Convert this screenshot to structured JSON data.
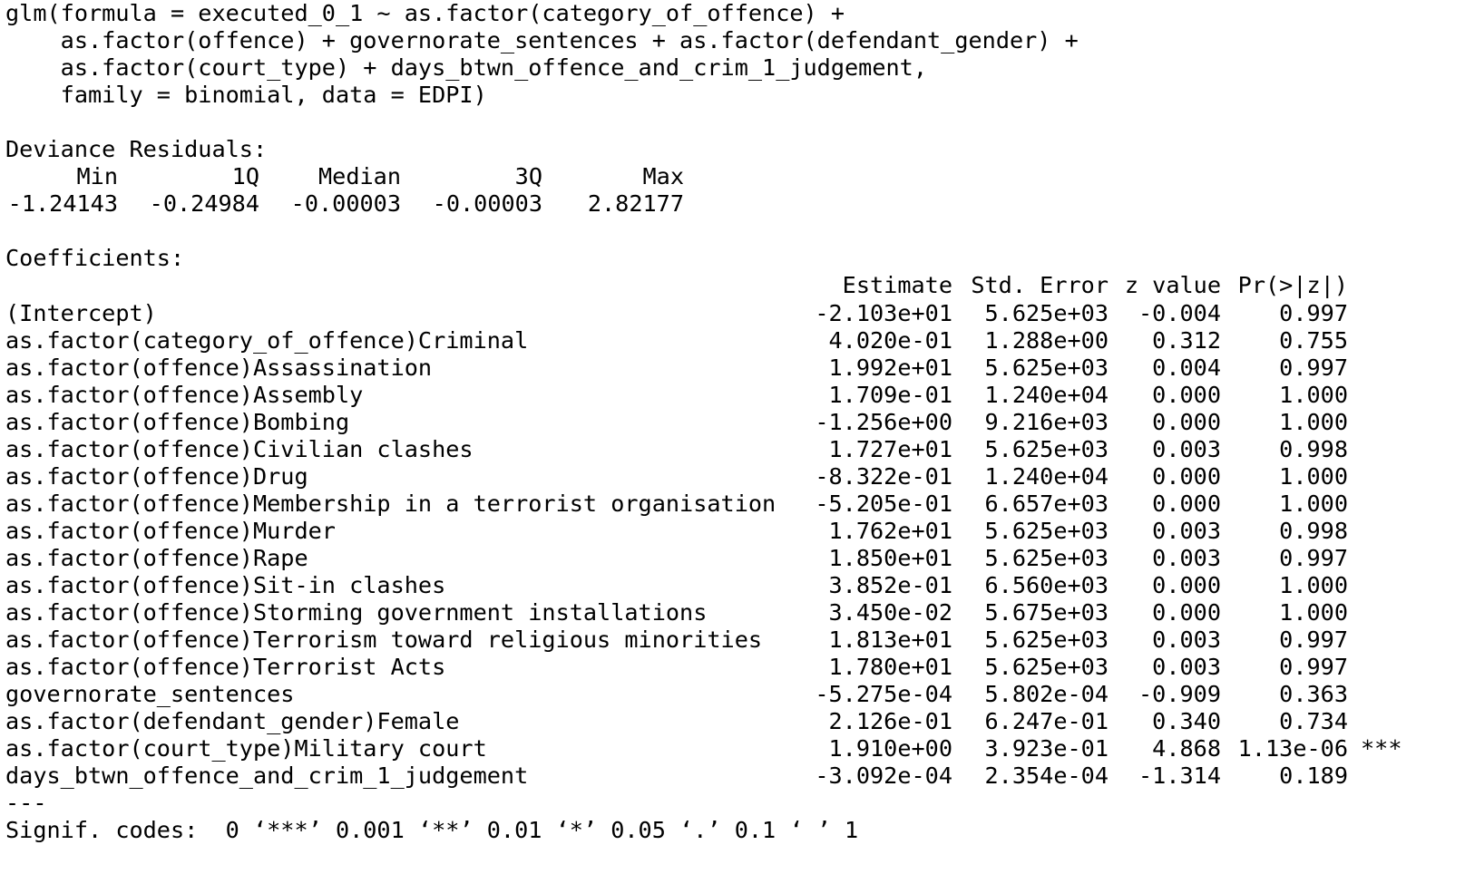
{
  "call": {
    "lines": [
      "glm(formula = executed_0_1 ~ as.factor(category_of_offence) +",
      "    as.factor(offence) + governorate_sentences + as.factor(defendant_gender) +",
      "    as.factor(court_type) + days_btwn_offence_and_crim_1_judgement,",
      "    family = binomial, data = EDPI)"
    ]
  },
  "residuals": {
    "title": "Deviance Residuals:",
    "headers": [
      "Min",
      "1Q",
      "Median",
      "3Q",
      "Max"
    ],
    "values": [
      "-1.24143",
      "-0.24984",
      "-0.00003",
      "-0.00003",
      "2.82177"
    ]
  },
  "coefficients": {
    "title": "Coefficients:",
    "headers": [
      "Estimate",
      "Std. Error",
      "z value",
      "Pr(>|z|)"
    ],
    "rows": [
      {
        "name": "(Intercept)",
        "estimate": "-2.103e+01",
        "std_error": "5.625e+03",
        "z": "-0.004",
        "p": "0.997",
        "sig": ""
      },
      {
        "name": "as.factor(category_of_offence)Criminal",
        "estimate": "4.020e-01",
        "std_error": "1.288e+00",
        "z": "0.312",
        "p": "0.755",
        "sig": ""
      },
      {
        "name": "as.factor(offence)Assassination",
        "estimate": "1.992e+01",
        "std_error": "5.625e+03",
        "z": "0.004",
        "p": "0.997",
        "sig": ""
      },
      {
        "name": "as.factor(offence)Assembly",
        "estimate": "1.709e-01",
        "std_error": "1.240e+04",
        "z": "0.000",
        "p": "1.000",
        "sig": ""
      },
      {
        "name": "as.factor(offence)Bombing",
        "estimate": "-1.256e+00",
        "std_error": "9.216e+03",
        "z": "0.000",
        "p": "1.000",
        "sig": ""
      },
      {
        "name": "as.factor(offence)Civilian clashes",
        "estimate": "1.727e+01",
        "std_error": "5.625e+03",
        "z": "0.003",
        "p": "0.998",
        "sig": ""
      },
      {
        "name": "as.factor(offence)Drug",
        "estimate": "-8.322e-01",
        "std_error": "1.240e+04",
        "z": "0.000",
        "p": "1.000",
        "sig": ""
      },
      {
        "name": "as.factor(offence)Membership in a terrorist organisation",
        "estimate": "-5.205e-01",
        "std_error": "6.657e+03",
        "z": "0.000",
        "p": "1.000",
        "sig": ""
      },
      {
        "name": "as.factor(offence)Murder",
        "estimate": "1.762e+01",
        "std_error": "5.625e+03",
        "z": "0.003",
        "p": "0.998",
        "sig": ""
      },
      {
        "name": "as.factor(offence)Rape",
        "estimate": "1.850e+01",
        "std_error": "5.625e+03",
        "z": "0.003",
        "p": "0.997",
        "sig": ""
      },
      {
        "name": "as.factor(offence)Sit-in clashes",
        "estimate": "3.852e-01",
        "std_error": "6.560e+03",
        "z": "0.000",
        "p": "1.000",
        "sig": ""
      },
      {
        "name": "as.factor(offence)Storming government installations",
        "estimate": "3.450e-02",
        "std_error": "5.675e+03",
        "z": "0.000",
        "p": "1.000",
        "sig": ""
      },
      {
        "name": "as.factor(offence)Terrorism toward religious minorities",
        "estimate": "1.813e+01",
        "std_error": "5.625e+03",
        "z": "0.003",
        "p": "0.997",
        "sig": ""
      },
      {
        "name": "as.factor(offence)Terrorist Acts",
        "estimate": "1.780e+01",
        "std_error": "5.625e+03",
        "z": "0.003",
        "p": "0.997",
        "sig": ""
      },
      {
        "name": "governorate_sentences",
        "estimate": "-5.275e-04",
        "std_error": "5.802e-04",
        "z": "-0.909",
        "p": "0.363",
        "sig": ""
      },
      {
        "name": "as.factor(defendant_gender)Female",
        "estimate": "2.126e-01",
        "std_error": "6.247e-01",
        "z": "0.340",
        "p": "0.734",
        "sig": ""
      },
      {
        "name": "as.factor(court_type)Military court",
        "estimate": "1.910e+00",
        "std_error": "3.923e-01",
        "z": "4.868",
        "p": "1.13e-06",
        "sig": "***"
      },
      {
        "name": "days_btwn_offence_and_crim_1_judgement",
        "estimate": "-3.092e-04",
        "std_error": "2.354e-04",
        "z": "-1.314",
        "p": "0.189",
        "sig": ""
      }
    ]
  },
  "separator": "---",
  "signif_codes": "Signif. codes:  0 ‘***’ 0.001 ‘**’ 0.01 ‘*’ 0.05 ‘.’ 0.1 ‘ ’ 1"
}
